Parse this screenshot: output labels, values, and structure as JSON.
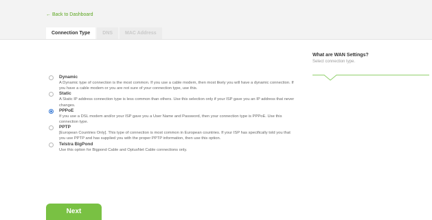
{
  "nav": {
    "back_arrow": "←",
    "back_label": "Back to Dashboard"
  },
  "tabs": [
    {
      "label": "Connection Type",
      "active": true
    },
    {
      "label": "DNS",
      "active": false
    },
    {
      "label": "MAC Address",
      "active": false
    }
  ],
  "options": [
    {
      "title": "Dynamic",
      "description": "A Dynamic type of connection is the most common. If you use a cable modem, then most likely you will have a dynamic connection. If you have a cable modem or you are not sure of your connection type, use this.",
      "selected": false
    },
    {
      "title": "Static",
      "description": "A Static IP address connection type is less common than others. Use this selection only if your ISP gave you an IP address that never changes.",
      "selected": false
    },
    {
      "title": "PPPoE",
      "description": "If you use a DSL modem and/or your ISP gave you a User Name and Password, then your connection type is PPPoE. Use this connection type.",
      "selected": true
    },
    {
      "title": "PPTP",
      "description": "[European Countries Only]. This type of connection is most common in European countries. If your ISP has specifically told you that you use PPTP and has supplied you with the proper PPTP information, then use this option.",
      "selected": false
    },
    {
      "title": "Telstra BigPond",
      "description": "Use this option for Bigpond Cable and OptusNet Cable connections only.",
      "selected": false
    }
  ],
  "sidebar": {
    "title": "What are WAN Settings?",
    "subtitle": "Select connection type."
  },
  "actions": {
    "next_label": "Next"
  },
  "colors": {
    "accent_green": "#79c143",
    "link_green": "#5aa51e",
    "selected_blue": "#3a7bd5"
  }
}
